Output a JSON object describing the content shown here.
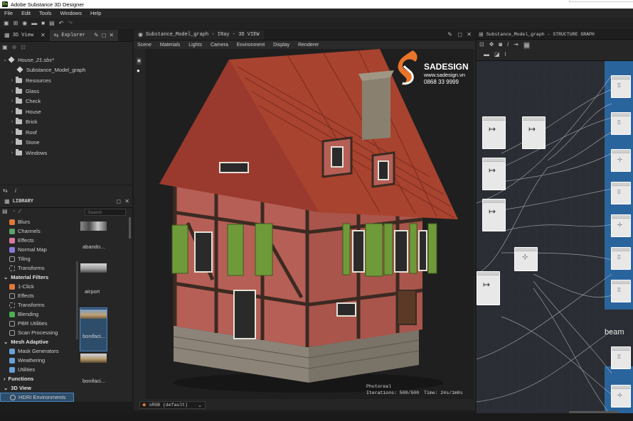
{
  "app": {
    "title": "Adobe Substance 3D Designer"
  },
  "menu": [
    "File",
    "Edit",
    "Tools",
    "Windows",
    "Help"
  ],
  "explorer": {
    "tabs": [
      {
        "label": "3D View"
      },
      {
        "label": "Explorer"
      }
    ],
    "package": "House_21.sbs*",
    "items": [
      {
        "label": "Substance_Model_graph",
        "type": "graph"
      },
      {
        "label": "Resources",
        "type": "folder"
      },
      {
        "label": "Glass",
        "type": "folder"
      },
      {
        "label": "Check",
        "type": "folder"
      },
      {
        "label": "House",
        "type": "folder"
      },
      {
        "label": "Brick",
        "type": "folder"
      },
      {
        "label": "Roof",
        "type": "folder"
      },
      {
        "label": "Stone",
        "type": "folder"
      },
      {
        "label": "Windows",
        "type": "folder"
      }
    ]
  },
  "library": {
    "title": "LIBRARY",
    "search_placeholder": "Search",
    "categories": [
      {
        "label": "Blurs",
        "color": "#e0783a",
        "header": false
      },
      {
        "label": "Channels",
        "color": "#5aa36a",
        "header": false
      },
      {
        "label": "Effects",
        "color": "#d87aa0",
        "header": false
      },
      {
        "label": "Normal Map",
        "color": "#8a7ad8",
        "header": false
      },
      {
        "label": "Tiling",
        "color": "#a0a0a0",
        "header": false
      },
      {
        "label": "Transforms",
        "color": "#a0a0a0",
        "header": false
      },
      {
        "label": "Material Filters",
        "color": "",
        "header": true
      },
      {
        "label": "1-Click",
        "color": "#e0783a",
        "header": false
      },
      {
        "label": "Effects",
        "color": "#a0a0a0",
        "header": false
      },
      {
        "label": "Transforms",
        "color": "#a0a0a0",
        "header": false
      },
      {
        "label": "Blending",
        "color": "#4caf50",
        "header": false
      },
      {
        "label": "PBR Utilities",
        "color": "#a0a0a0",
        "header": false
      },
      {
        "label": "Scan Processing",
        "color": "#a0a0a0",
        "header": false
      },
      {
        "label": "Mesh Adaptive",
        "color": "",
        "header": true
      },
      {
        "label": "Mask Generators",
        "color": "#6aa0d8",
        "header": false
      },
      {
        "label": "Weathering",
        "color": "#6aa0d8",
        "header": false
      },
      {
        "label": "Utilities",
        "color": "#6aa0d8",
        "header": false
      },
      {
        "label": "Functions",
        "color": "",
        "header": true
      },
      {
        "label": "3D View",
        "color": "",
        "header": true
      },
      {
        "label": "HDRI Environments",
        "color": "#a0a0a0",
        "header": false,
        "selected": true
      }
    ],
    "thumbnails": [
      "abando...",
      "airport",
      "bonifaci...",
      "bonifaci..."
    ]
  },
  "view3d": {
    "title": "Substance_Model_graph - IRay - 3D VIEW",
    "menu": [
      "Scene",
      "Materials",
      "Lights",
      "Camera",
      "Environment",
      "Display",
      "Renderer"
    ],
    "render_mode": "Photoreal",
    "iterations": "Iterations: 500/500",
    "time": "Time: 24s/1m0s",
    "colorspace": "sRGB (default)",
    "watermark": {
      "brand": "SADESIGN",
      "url": "www.sadesign.vn",
      "phone": "0868 33 9999"
    }
  },
  "graph": {
    "title": "Substance_Model_graph - STRUCTURE GRAPH",
    "frame_label": "beam"
  },
  "colors": {
    "accent": "#4a86c4",
    "roof": "#9a3a2e",
    "wall": "#b65f56",
    "shutter": "#6f9a3a",
    "frame": "#2a6aa8"
  }
}
